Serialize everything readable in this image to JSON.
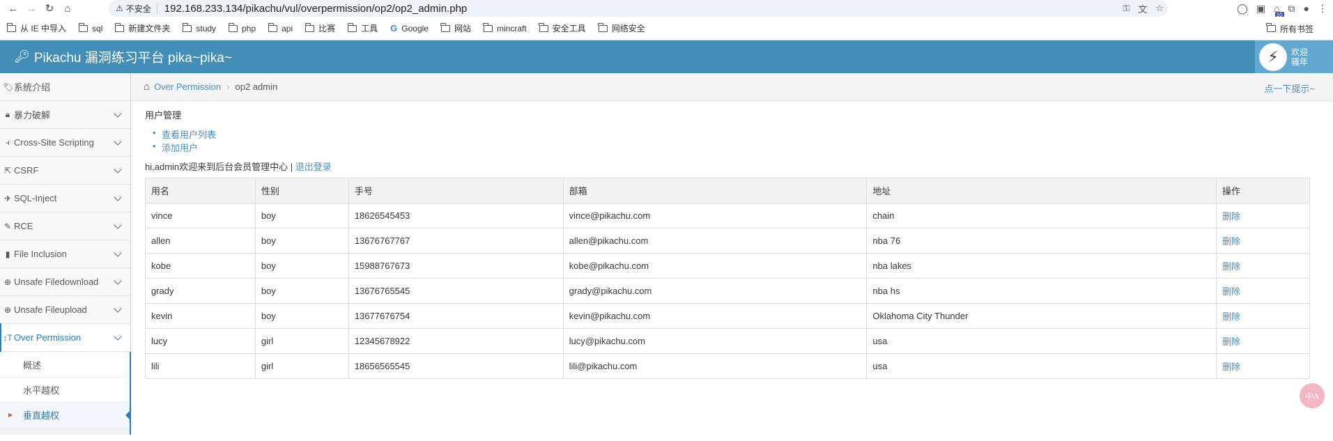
{
  "browser": {
    "insecure_label": "不安全",
    "url": "192.168.233.134/pikachu/vul/overpermission/op2/op2_admin.php",
    "ext_badge": "10",
    "bookmarks": [
      "从 IE 中导入",
      "sql",
      "新建文件夹",
      "study",
      "php",
      "api",
      "比赛",
      "工具",
      "Google",
      "网站",
      "mincraft",
      "安全工具",
      "网络安全"
    ],
    "bookmarks_right": "所有书签"
  },
  "header": {
    "title": "Pikachu 漏洞练习平台 pika~pika~",
    "welcome_line1": "欢迎",
    "welcome_line2": "骚年"
  },
  "sidebar": {
    "items": [
      {
        "label": "系统介绍",
        "icon": "tags-icon"
      },
      {
        "label": "暴力破解",
        "icon": "lock-icon"
      },
      {
        "label": "Cross-Site Scripting",
        "icon": "sitemap-icon"
      },
      {
        "label": "CSRF",
        "icon": "share-icon"
      },
      {
        "label": "SQL-Inject",
        "icon": "fighter-jet-icon"
      },
      {
        "label": "RCE",
        "icon": "pencil-icon"
      },
      {
        "label": "File Inclusion",
        "icon": "file-icon"
      },
      {
        "label": "Unsafe Filedownload",
        "icon": "download-icon"
      },
      {
        "label": "Unsafe Fileupload",
        "icon": "upload-icon"
      },
      {
        "label": "Over Permission",
        "icon": "text-height-icon"
      }
    ],
    "sub_items": [
      "概述",
      "水平越权",
      "垂直越权"
    ]
  },
  "breadcrumb": {
    "parent": "Over Permission",
    "current": "op2 admin",
    "hint": "点一下提示~"
  },
  "page": {
    "section_title": "用户管理",
    "links": [
      "查看用户列表",
      "添加用户"
    ],
    "greeting": "hi,admin欢迎来到后台会员管理中心 | ",
    "logout": "退出登录"
  },
  "table": {
    "headers": [
      "用名",
      "性别",
      "手号",
      "部箱",
      "地址",
      "操作"
    ],
    "rows": [
      [
        "vince",
        "boy",
        "18626545453",
        "vince@pikachu.com",
        "chain",
        "删除"
      ],
      [
        "allen",
        "boy",
        "13676767767",
        "allen@pikachu.com",
        "nba 76",
        "删除"
      ],
      [
        "kobe",
        "boy",
        "15988767673",
        "kobe@pikachu.com",
        "nba lakes",
        "删除"
      ],
      [
        "grady",
        "boy",
        "13676765545",
        "grady@pikachu.com",
        "nba hs",
        "删除"
      ],
      [
        "kevin",
        "boy",
        "13677676754",
        "kevin@pikachu.com",
        "Oklahoma City Thunder",
        "删除"
      ],
      [
        "lucy",
        "girl",
        "12345678922",
        "lucy@pikachu.com",
        "usa",
        "删除"
      ],
      [
        "lili",
        "girl",
        "18656565545",
        "lili@pikachu.com",
        "usa",
        "删除"
      ]
    ]
  },
  "float_button": "中A"
}
